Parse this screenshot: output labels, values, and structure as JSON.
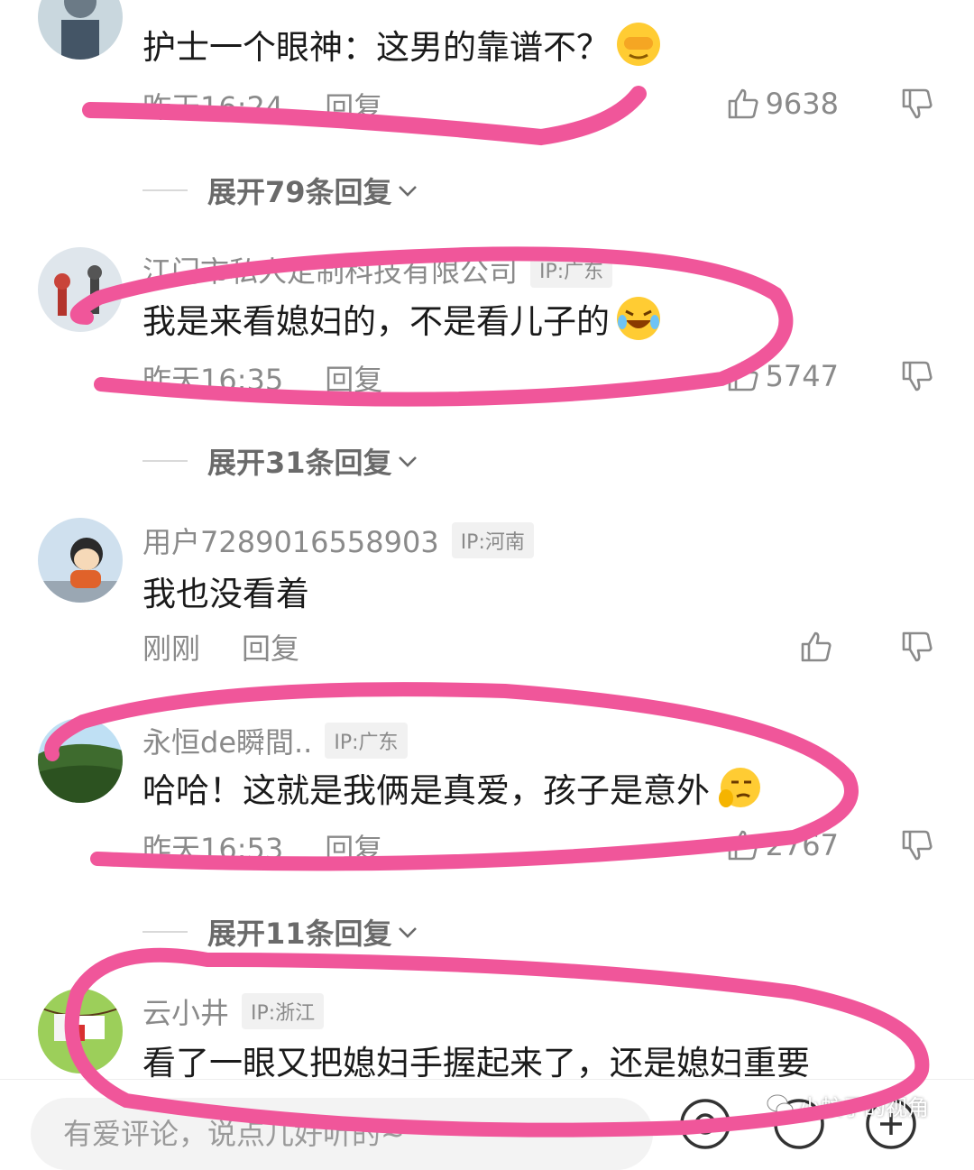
{
  "comments": [
    {
      "text": "护士一个眼神：这男的靠谱不？",
      "time": "昨天16:24",
      "reply_label": "回复",
      "likes": "9638",
      "expand": "展开79条回复",
      "emoji": "covering-face-emoji"
    },
    {
      "username": "江门市私人定制科技有限公司",
      "ip": "IP:广东",
      "text": "我是来看媳妇的，不是看儿子的",
      "time": "昨天16:35",
      "reply_label": "回复",
      "likes": "5747",
      "expand": "展开31条回复",
      "emoji": "laughing-tears-emoji"
    },
    {
      "username": "用户7289016558903",
      "ip": "IP:河南",
      "text": "我也没看着",
      "time": "刚刚",
      "reply_label": "回复",
      "likes": ""
    },
    {
      "username": "永恒de瞬間..",
      "ip": "IP:广东",
      "text": "哈哈！这就是我俩是真爱，孩子是意外",
      "time": "昨天16:53",
      "reply_label": "回复",
      "likes": "2767",
      "expand": "展开11条回复",
      "emoji": "smirk-thinking-emoji"
    },
    {
      "username": "云小井",
      "ip": "IP:浙江",
      "text": "看了一眼又把媳妇手握起来了，还是媳妇重要"
    }
  ],
  "input_placeholder": "有爱评论，说点儿好听的~",
  "watermark": "小蚊子的视角",
  "colors": {
    "highlight": "#f0569a",
    "text": "#1a1a1a",
    "meta": "#8a8a8a"
  }
}
